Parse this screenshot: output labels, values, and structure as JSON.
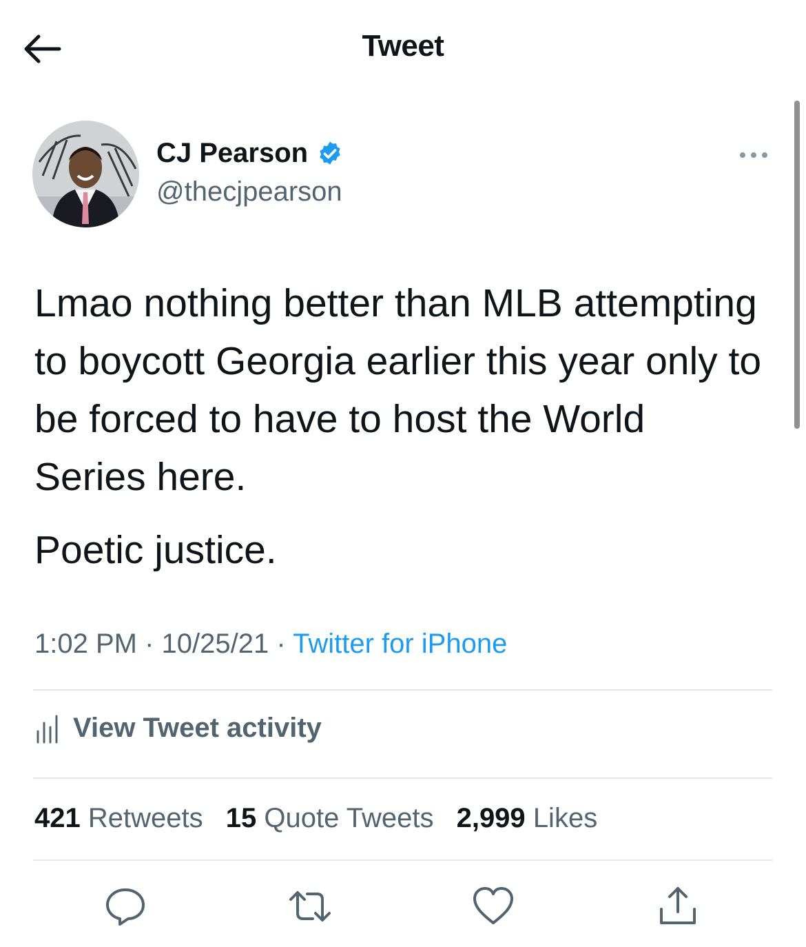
{
  "header": {
    "title": "Tweet",
    "back_icon": "arrow-left-icon"
  },
  "author": {
    "display_name": "CJ Pearson",
    "handle": "@thecjpearson",
    "verified": true,
    "verified_color": "#1d9bf0"
  },
  "tweet": {
    "paragraphs": [
      "Lmao nothing better than MLB attempting to boycott Georgia earlier this year only to be forced to have to host the World Series here.",
      "Poetic justice."
    ],
    "time": "1:02 PM",
    "date": "10/25/21",
    "separator": "·",
    "source": "Twitter for iPhone"
  },
  "activity": {
    "label": "View Tweet activity",
    "icon": "bar-chart-icon"
  },
  "stats": {
    "retweets": {
      "count": "421",
      "label": "Retweets"
    },
    "quotes": {
      "count": "15",
      "label": "Quote Tweets"
    },
    "likes": {
      "count": "2,999",
      "label": "Likes"
    }
  },
  "actions": [
    "reply-icon",
    "retweet-icon",
    "like-icon",
    "share-icon"
  ],
  "colors": {
    "accent": "#1d9bf0",
    "text": "#0f1419",
    "secondary": "#536471",
    "divider": "#e4e7ea"
  }
}
